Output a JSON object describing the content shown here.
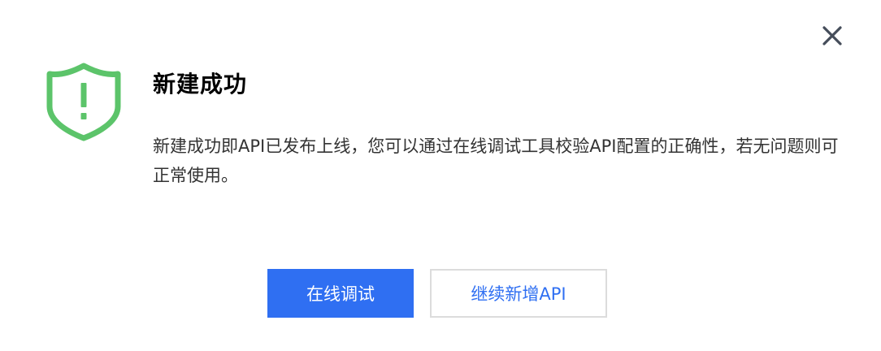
{
  "dialog": {
    "title": "新建成功",
    "message": "新建成功即API已发布上线，您可以通过在线调试工具校验API配置的正确性，若无问题则可正常使用。",
    "status_icon": "shield-exclamation-icon",
    "close_icon": "close-icon",
    "primary_button_label": "在线调试",
    "secondary_button_label": "继续新增API"
  },
  "colors": {
    "success_green": "#5cc46a",
    "primary_blue": "#2f6ff2",
    "close_gray": "#454d5a",
    "border_gray": "#dcdcdc"
  }
}
